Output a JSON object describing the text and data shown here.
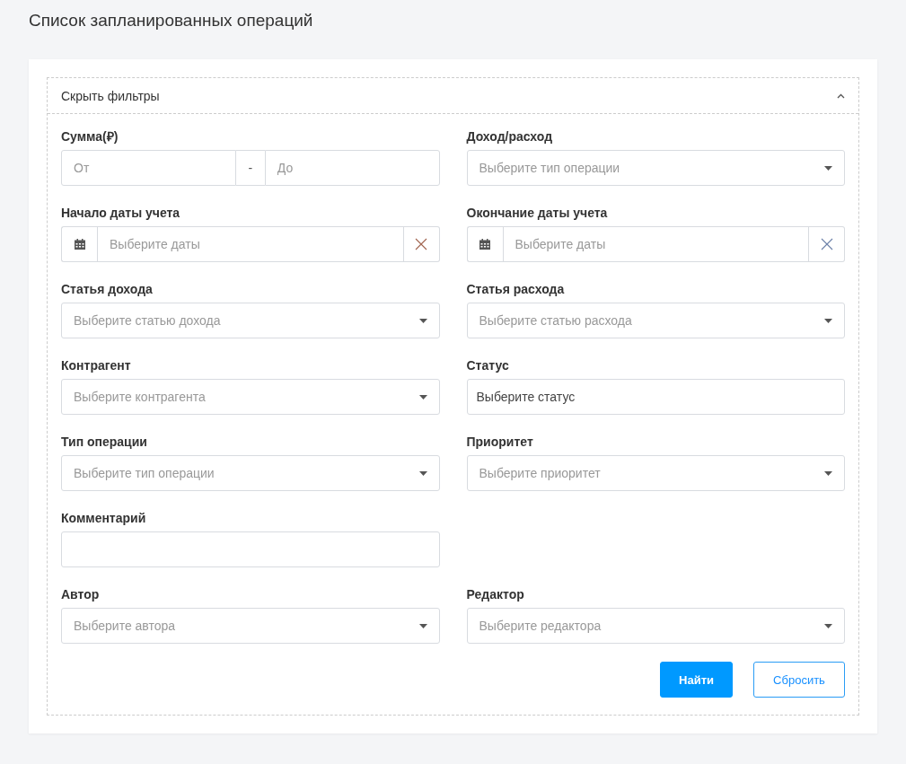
{
  "page_title": "Список запланированных операций",
  "filters_panel": {
    "toggle_label": "Скрыть фильтры",
    "expanded": true,
    "fields": [
      {
        "kind": "range",
        "label": "Сумма(₽)",
        "from_placeholder": "От",
        "separator": "-",
        "to_placeholder": "До"
      },
      {
        "kind": "select",
        "label": "Доход/расход",
        "placeholder": "Выберите тип операции"
      },
      {
        "kind": "date",
        "label": "Начало даты учета",
        "placeholder": "Выберите даты"
      },
      {
        "kind": "date",
        "label": "Окончание даты учета",
        "placeholder": "Выберите даты"
      },
      {
        "kind": "select",
        "label": "Статья дохода",
        "placeholder": "Выберите статью дохода"
      },
      {
        "kind": "select",
        "label": "Статья расхода",
        "placeholder": "Выберите статью расхода"
      },
      {
        "kind": "select",
        "label": "Контрагент",
        "placeholder": "Выберите контрагента"
      },
      {
        "kind": "text",
        "label": "Статус",
        "value": "Выберите статус"
      },
      {
        "kind": "select",
        "label": "Тип операции",
        "placeholder": "Выберите тип операции"
      },
      {
        "kind": "select",
        "label": "Приоритет",
        "placeholder": "Выберите приоритет"
      },
      {
        "kind": "text_single",
        "label": "Комментарий"
      },
      {
        "kind": "select",
        "label": "Автор",
        "placeholder": "Выберите автора"
      },
      {
        "kind": "select",
        "label": "Редактор",
        "placeholder": "Выберите редактора"
      }
    ],
    "buttons": [
      {
        "kind": "primary",
        "label": "Найти"
      },
      {
        "kind": "secondary",
        "label": "Сбросить"
      }
    ]
  }
}
